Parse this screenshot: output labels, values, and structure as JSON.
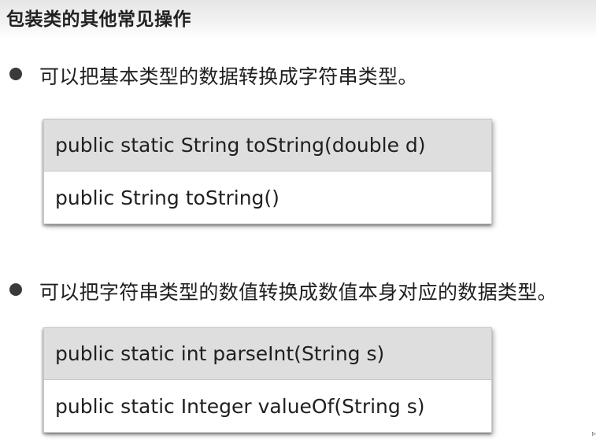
{
  "page": {
    "title": "包装类的其他常见操作"
  },
  "sections": [
    {
      "bullet_text": "可以把基本类型的数据转换成字符串类型。",
      "methods": [
        "public static String toString(double d)",
        "public String toString()"
      ]
    },
    {
      "bullet_text": "可以把字符串类型的数值转换成数值本身对应的数据类型。",
      "methods": [
        "public static int parseInt(String s)",
        "public static Integer valueOf(String s)"
      ]
    }
  ]
}
